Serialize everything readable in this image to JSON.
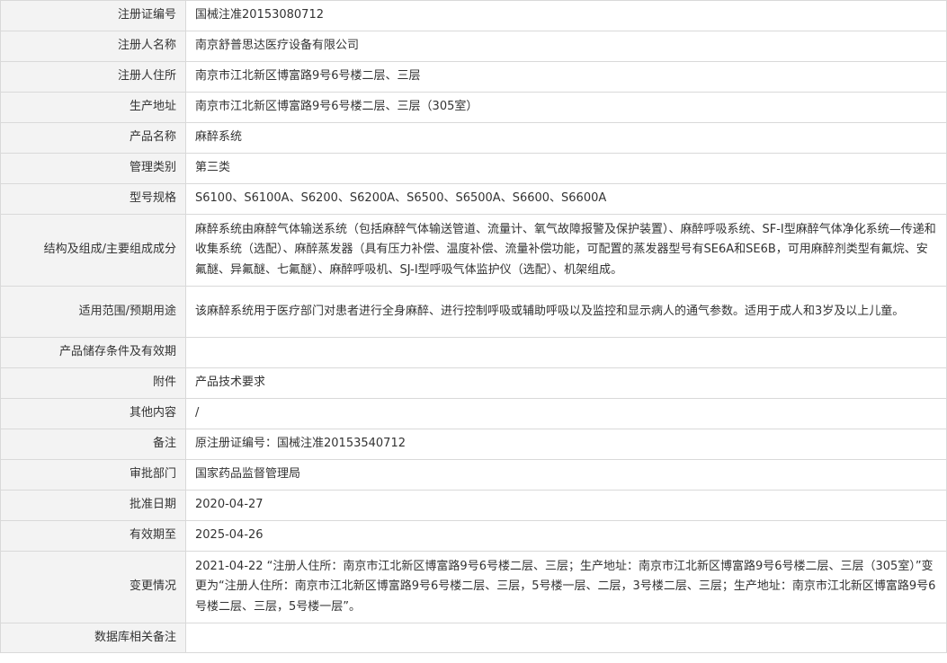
{
  "rows": [
    {
      "label": "注册证编号",
      "value": "国械注准20153080712"
    },
    {
      "label": "注册人名称",
      "value": "南京舒普思达医疗设备有限公司"
    },
    {
      "label": "注册人住所",
      "value": "南京市江北新区博富路9号6号楼二层、三层"
    },
    {
      "label": "生产地址",
      "value": "南京市江北新区博富路9号6号楼二层、三层（305室）"
    },
    {
      "label": "产品名称",
      "value": "麻醉系统"
    },
    {
      "label": "管理类别",
      "value": "第三类"
    },
    {
      "label": "型号规格",
      "value": "S6100、S6100A、S6200、S6200A、S6500、S6500A、S6600、S6600A"
    },
    {
      "label": "结构及组成/主要组成成分",
      "value": "麻醉系统由麻醉气体输送系统（包括麻醉气体输送管道、流量计、氧气故障报警及保护装置）、麻醉呼吸系统、SF-I型麻醉气体净化系统—传递和收集系统（选配）、麻醉蒸发器（具有压力补偿、温度补偿、流量补偿功能，可配置的蒸发器型号有SE6A和SE6B，可用麻醉剂类型有氟烷、安氟醚、异氟醚、七氟醚）、麻醉呼吸机、SJ-I型呼吸气体监护仪（选配）、机架组成。"
    },
    {
      "label": "适用范围/预期用途",
      "value": "该麻醉系统用于医疗部门对患者进行全身麻醉、进行控制呼吸或辅助呼吸以及监控和显示病人的通气参数。适用于成人和3岁及以上儿童。"
    },
    {
      "label": "产品储存条件及有效期",
      "value": ""
    },
    {
      "label": "附件",
      "value": "产品技术要求"
    },
    {
      "label": "其他内容",
      "value": "/"
    },
    {
      "label": "备注",
      "value": "原注册证编号：国械注准20153540712"
    },
    {
      "label": "审批部门",
      "value": "国家药品监督管理局"
    },
    {
      "label": "批准日期",
      "value": "2020-04-27"
    },
    {
      "label": "有效期至",
      "value": "2025-04-26"
    },
    {
      "label": "变更情况",
      "value": "2021-04-22 “注册人住所：南京市江北新区博富路9号6号楼二层、三层；生产地址：南京市江北新区博富路9号6号楼二层、三层（305室）”变更为“注册人住所：南京市江北新区博富路9号6号楼二层、三层，5号楼一层、二层，3号楼二层、三层；生产地址：南京市江北新区博富路9号6号楼二层、三层，5号楼一层”。"
    },
    {
      "label": "数据库相关备注",
      "value": ""
    }
  ]
}
